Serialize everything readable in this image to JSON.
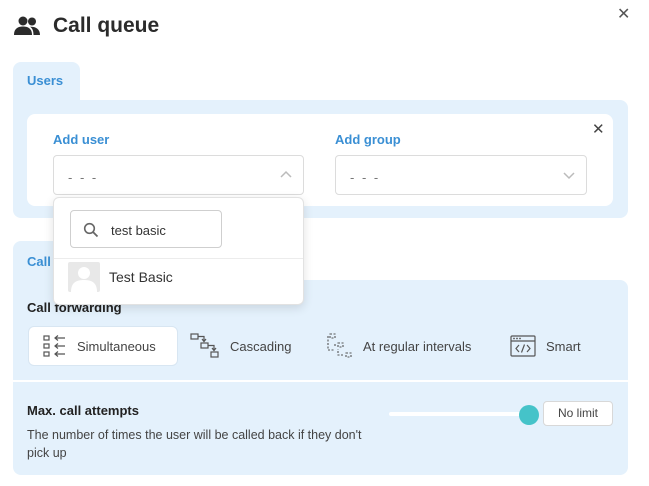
{
  "header": {
    "title": "Call queue",
    "icon": "people-icon"
  },
  "tabs": {
    "users": "Users",
    "call": "Call"
  },
  "users_card": {
    "add_user": {
      "label": "Add user",
      "value": "- - -"
    },
    "add_group": {
      "label": "Add group",
      "value": "- - -"
    }
  },
  "dropdown": {
    "search_value": "test basic",
    "results": [
      {
        "label": "Test Basic"
      }
    ]
  },
  "call_forwarding": {
    "title": "Call forwarding",
    "options": [
      {
        "label": "Simultaneous",
        "active": true
      },
      {
        "label": "Cascading"
      },
      {
        "label": "At regular intervals"
      },
      {
        "label": "Smart"
      }
    ]
  },
  "max_attempts": {
    "title": "Max. call attempts",
    "description": "The number of times the user will be called back if they don't pick up",
    "value_label": "No limit",
    "slider_value_percent": 100
  },
  "colors": {
    "accent": "#3a8fd4",
    "panel": "#e4f1fc",
    "slider_knob": "#45c3c9"
  }
}
